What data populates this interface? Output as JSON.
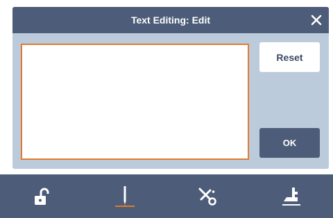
{
  "dialog": {
    "title": "Text Editing: Edit",
    "text_value": "",
    "reset_label": "Reset",
    "ok_label": "OK"
  },
  "toolbar": {
    "items": [
      {
        "icon": "unlock-icon",
        "active": false
      },
      {
        "icon": "needle-icon",
        "active": true
      },
      {
        "icon": "scissors-icon",
        "active": false
      },
      {
        "icon": "presser-foot-icon",
        "active": false
      }
    ]
  },
  "colors": {
    "header": "#4d5c78",
    "panel": "#bccbdc",
    "accent": "#e07b2e",
    "icon": "#ffffff"
  }
}
